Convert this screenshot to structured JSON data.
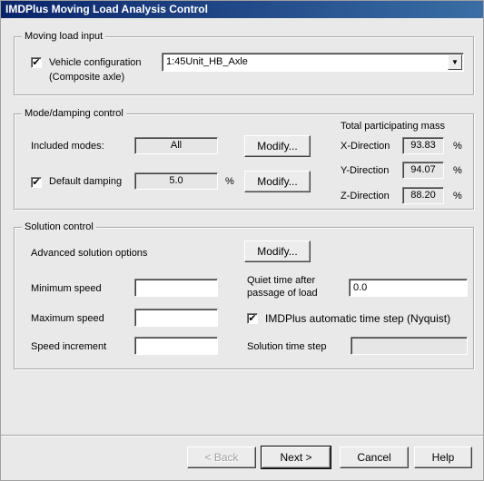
{
  "window": {
    "title": "IMDPlus Moving Load Analysis Control"
  },
  "moving_load": {
    "legend": "Moving load input",
    "vehicle_checked": true,
    "vehicle_label": "Vehicle configuration",
    "vehicle_sublabel": "(Composite axle)",
    "vehicle_value": "1:45Unit_HB_Axle",
    "check_mark": "✔",
    "dropdown_glyph": "▼"
  },
  "mode_damping": {
    "legend": "Mode/damping control",
    "included_modes_label": "Included modes:",
    "included_modes_value": "All",
    "modify_label": "Modify...",
    "default_damping_label": "Default damping",
    "default_damping_checked": true,
    "default_damping_value": "5.0",
    "percent": "%",
    "mass_heading": "Total participating mass",
    "directions": [
      {
        "label": "X-Direction",
        "value": "93.83"
      },
      {
        "label": "Y-Direction",
        "value": "94.07"
      },
      {
        "label": "Z-Direction",
        "value": "88.20"
      }
    ]
  },
  "solution": {
    "legend": "Solution control",
    "advanced_label": "Advanced solution options",
    "modify_label": "Modify...",
    "min_speed_label": "Minimum speed",
    "min_speed_value": "",
    "max_speed_label": "Maximum speed",
    "max_speed_value": "",
    "speed_increment_label": "Speed increment",
    "speed_increment_value": "",
    "quiet_time_label_1": "Quiet time after",
    "quiet_time_label_2": "passage of load",
    "quiet_time_value": "0.0",
    "auto_step_checked": true,
    "auto_step_label": "IMDPlus automatic time step (Nyquist)",
    "time_step_label": "Solution time step",
    "time_step_value": ""
  },
  "footer": {
    "back": "< Back",
    "next": "Next >",
    "cancel": "Cancel",
    "help": "Help"
  }
}
